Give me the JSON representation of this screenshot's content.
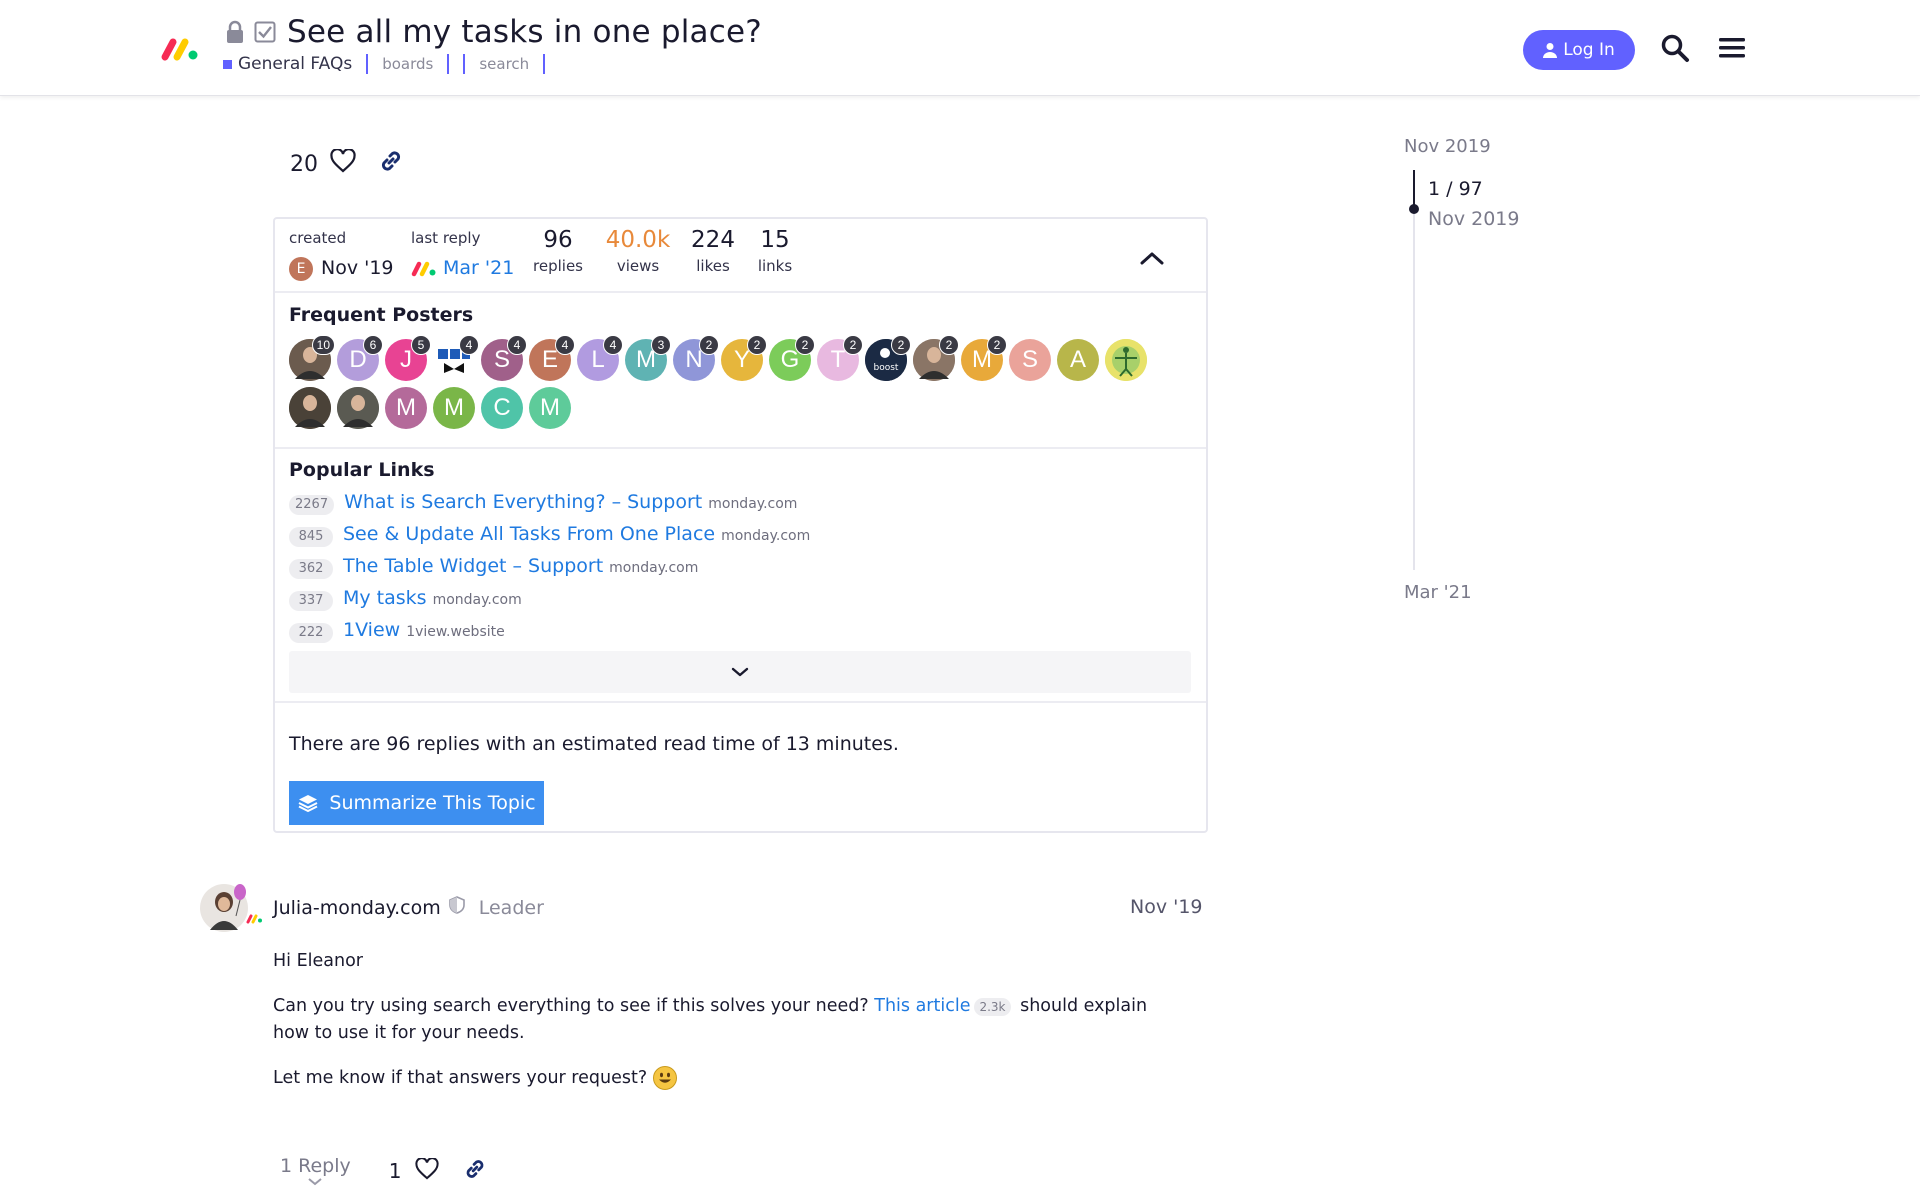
{
  "header": {
    "title": "See all my tasks in one place?",
    "category": "General FAQs",
    "tags": [
      "boards",
      "search"
    ],
    "login_label": "Log In",
    "colors": {
      "accent": "#6161ff",
      "category": "#6161ff"
    }
  },
  "post_actions": {
    "likes": "20"
  },
  "topic_map": {
    "created_label": "created",
    "created_date": "Nov '19",
    "created_avatar_letter": "E",
    "last_reply_label": "last reply",
    "last_reply_date": "Mar '21",
    "stats": [
      {
        "value": "96",
        "label": "replies"
      },
      {
        "value": "40.0k",
        "label": "views"
      },
      {
        "value": "224",
        "label": "likes"
      },
      {
        "value": "15",
        "label": "links"
      }
    ],
    "frequent_posters_title": "Frequent Posters",
    "posters_row1": [
      {
        "letter": "",
        "count": "10",
        "color": "#6b5b4e",
        "kind": "photo"
      },
      {
        "letter": "D",
        "count": "6",
        "color": "#b39ddb"
      },
      {
        "letter": "J",
        "count": "5",
        "color": "#e84393"
      },
      {
        "letter": "",
        "count": "4",
        "color": "#1e5bb8",
        "kind": "logo"
      },
      {
        "letter": "S",
        "count": "4",
        "color": "#a0608a"
      },
      {
        "letter": "E",
        "count": "4",
        "color": "#c0755a"
      },
      {
        "letter": "L",
        "count": "4",
        "color": "#b19be0"
      },
      {
        "letter": "M",
        "count": "3",
        "color": "#5fb3b3"
      },
      {
        "letter": "N",
        "count": "2",
        "color": "#8f96d8"
      },
      {
        "letter": "Y",
        "count": "2",
        "color": "#e6b63c"
      },
      {
        "letter": "G",
        "count": "2",
        "color": "#7ccc5a"
      },
      {
        "letter": "T",
        "count": "2",
        "color": "#e8b9e0"
      },
      {
        "letter": "",
        "count": "2",
        "color": "#1b2a44",
        "kind": "boost"
      },
      {
        "letter": "",
        "count": "2",
        "color": "#8a7566",
        "kind": "photo"
      },
      {
        "letter": "M",
        "count": "2",
        "color": "#e8a93a"
      },
      {
        "letter": "S",
        "count": "",
        "color": "#eaa39a"
      },
      {
        "letter": "A",
        "count": "",
        "color": "#b8b64a"
      },
      {
        "letter": "",
        "count": "",
        "color": "#d6d64a",
        "kind": "figure"
      }
    ],
    "posters_row2": [
      {
        "letter": "",
        "count": "",
        "color": "#4a4238",
        "kind": "photo"
      },
      {
        "letter": "",
        "count": "",
        "color": "#5a5a52",
        "kind": "photo"
      },
      {
        "letter": "M",
        "count": "",
        "color": "#b46a9a"
      },
      {
        "letter": "M",
        "count": "",
        "color": "#7ab648"
      },
      {
        "letter": "C",
        "count": "",
        "color": "#4fc4a8"
      },
      {
        "letter": "M",
        "count": "",
        "color": "#5ecb9a"
      }
    ],
    "popular_links_title": "Popular Links",
    "links": [
      {
        "clicks": "2267",
        "title": "What is Search Everything? – Support",
        "domain": "monday.com"
      },
      {
        "clicks": "845",
        "title": "See & Update All Tasks From One Place",
        "domain": "monday.com"
      },
      {
        "clicks": "362",
        "title": "The Table Widget – Support",
        "domain": "monday.com"
      },
      {
        "clicks": "337",
        "title": "My tasks",
        "domain": "monday.com"
      },
      {
        "clicks": "222",
        "title": "1View",
        "domain": "1view.website"
      }
    ],
    "summary_text": "There are 96 replies with an estimated read time of 13 minutes.",
    "summarize_label": "Summarize This Topic"
  },
  "timeline": {
    "start_date": "Nov 2019",
    "position": "1 / 97",
    "position_date": "Nov 2019",
    "end_date": "Mar '21"
  },
  "reply": {
    "author": "Julia-monday.com",
    "user_title": "Leader",
    "date": "Nov '19",
    "greeting": "Hi Eleanor",
    "para1_before": "Can you try using search everything to see if this solves your need? ",
    "para1_link": "This article",
    "para1_link_clicks": "2.3k",
    "para1_after": " should explain how to use it for your needs.",
    "para2": "Let me know if that answers your request? ",
    "reply_count": "1 Reply",
    "likes": "1"
  }
}
